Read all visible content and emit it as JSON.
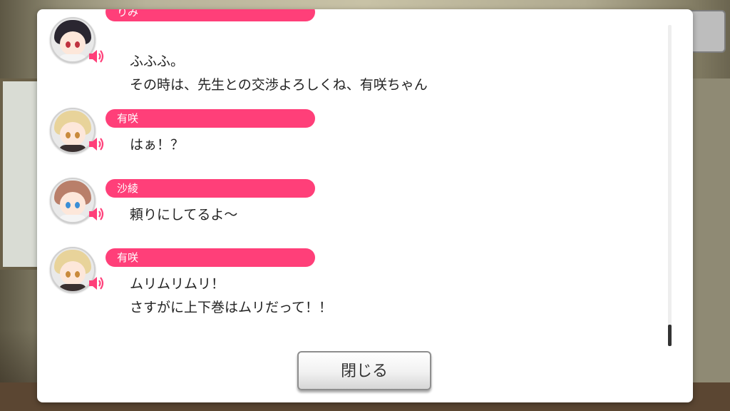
{
  "dialogue_log": {
    "entries": [
      {
        "speaker": "りみ",
        "lines": [
          "ふふふ。",
          "その時は、先生との交渉よろしくね、有咲ちゃん"
        ],
        "hair_color": "#2a2630",
        "eye_color": "#c0323f"
      },
      {
        "speaker": "有咲",
        "lines": [
          "はぁ！？"
        ],
        "hair_color": "#e8d39a",
        "eye_color": "#c98a3c"
      },
      {
        "speaker": "沙綾",
        "lines": [
          "頼りにしてるよ～"
        ],
        "hair_color": "#b97f6a",
        "eye_color": "#3b8fd6"
      },
      {
        "speaker": "有咲",
        "lines": [
          "ムリムリムリ！",
          "さすがに上下巻はムリだって！！"
        ],
        "hair_color": "#e8d39a",
        "eye_color": "#c98a3c"
      }
    ]
  },
  "close_button": {
    "label": "閉じる"
  },
  "colors": {
    "name_bar": "#ff3f79",
    "voice_icon": "#ff3f79"
  },
  "icons": {
    "voice": "speaker-icon"
  }
}
